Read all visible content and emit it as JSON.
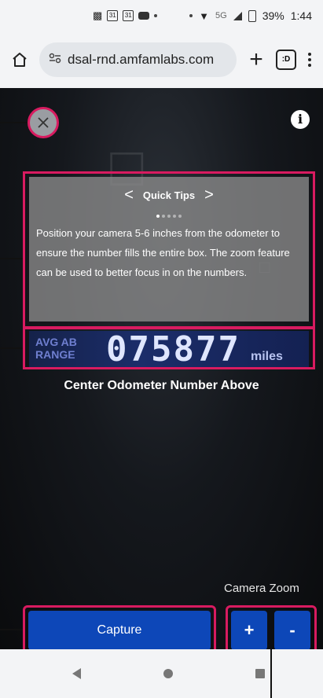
{
  "status_bar": {
    "notification_icons": [
      "teams-icon",
      "calendar-icon",
      "calendar-icon",
      "youtube-icon"
    ],
    "network": "5G",
    "battery": "39%",
    "time": "1:44"
  },
  "browser": {
    "url": "dsal-rnd.amfamlabs.com",
    "tab_count": ":D"
  },
  "tips": {
    "title": "Quick Tips",
    "prev": "<",
    "next": ">",
    "body": "Position your camera 5-6 inches from the odometer to ensure the number fills the entire box. The zoom feature can be used to better focus in on the numbers."
  },
  "odometer": {
    "side_line1": "AVG AB",
    "side_line2": "RANGE",
    "reading": "075877",
    "unit": "miles"
  },
  "instructions": "Center Odometer Number Above",
  "zoom": {
    "label": "Camera Zoom",
    "plus": "+",
    "minus": "-"
  },
  "capture_label": "Capture",
  "colors": {
    "highlight": "#d81b60",
    "button": "#0d47b8"
  }
}
